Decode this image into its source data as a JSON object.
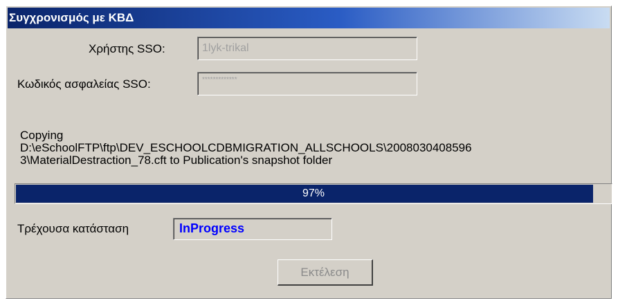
{
  "window": {
    "title": "Συγχρονισμός με ΚΒΔ"
  },
  "form": {
    "sso_user_label": "Χρήστης SSO:",
    "sso_user_value": "1lyk-trikal",
    "sso_password_label": "Κωδικός ασφαλείας SSO:",
    "sso_password_value": "*************"
  },
  "message": {
    "line1": "Copying",
    "line2": "D:\\eSchoolFTP\\ftp\\DEV_ESCHOOLCDBMIGRATION_ALLSCHOOLS\\2008030408596",
    "line3": "3\\MaterialDestraction_78.cft to Publication's snapshot folder"
  },
  "progress": {
    "percent": 97,
    "label": "97%"
  },
  "status": {
    "label": "Τρέχουσα κατάσταση",
    "value": "InProgress"
  },
  "actions": {
    "execute_label": "Εκτέλεση"
  },
  "colors": {
    "title_bar": "#0a246a",
    "progress_fill": "#0a246a",
    "status_text": "#0000ff",
    "panel": "#d4d0c8"
  }
}
